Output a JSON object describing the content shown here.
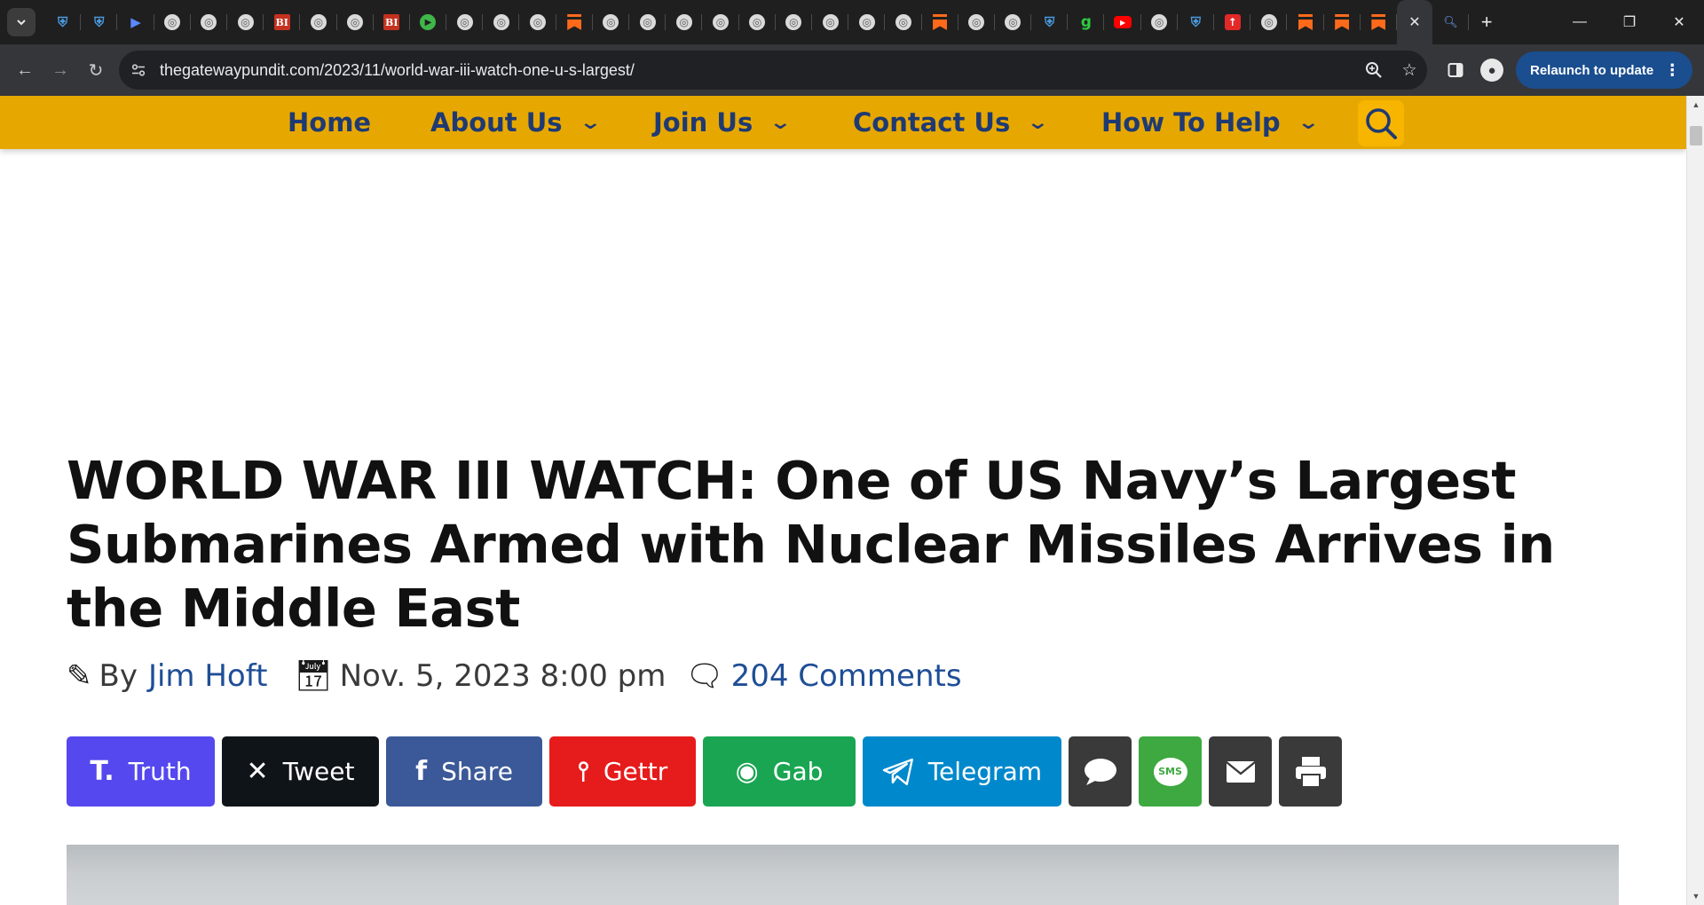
{
  "browser": {
    "url": "thegatewaypundit.com/2023/11/world-war-iii-watch-one-u-s-largest/",
    "relaunch_label": "Relaunch to update",
    "tabs": [
      {
        "icon": "shield-icon"
      },
      {
        "icon": "shield-icon"
      },
      {
        "icon": "play-badge-icon"
      },
      {
        "icon": "globe-icon"
      },
      {
        "icon": "globe-icon"
      },
      {
        "icon": "globe-icon"
      },
      {
        "icon": "bi-icon"
      },
      {
        "icon": "globe-icon"
      },
      {
        "icon": "globe-icon"
      },
      {
        "icon": "bi-icon"
      },
      {
        "icon": "play-icon"
      },
      {
        "icon": "globe-icon"
      },
      {
        "icon": "globe-icon"
      },
      {
        "icon": "globe-icon"
      },
      {
        "icon": "bookmark-flag-icon"
      },
      {
        "icon": "globe-icon"
      },
      {
        "icon": "globe-icon"
      },
      {
        "icon": "globe-icon"
      },
      {
        "icon": "globe-icon"
      },
      {
        "icon": "globe-icon"
      },
      {
        "icon": "globe-icon"
      },
      {
        "icon": "globe-icon"
      },
      {
        "icon": "globe-icon"
      },
      {
        "icon": "globe-icon"
      },
      {
        "icon": "bookmark-flag-icon"
      },
      {
        "icon": "globe-icon"
      },
      {
        "icon": "globe-icon"
      },
      {
        "icon": "shield-icon"
      },
      {
        "icon": "g-icon"
      },
      {
        "icon": "youtube-icon"
      },
      {
        "icon": "globe-icon"
      },
      {
        "icon": "shield-icon"
      },
      {
        "icon": "red-badge-icon"
      },
      {
        "icon": "globe-icon"
      },
      {
        "icon": "bookmark-flag-icon"
      },
      {
        "icon": "bookmark-flag-icon"
      },
      {
        "icon": "bookmark-flag-icon"
      }
    ]
  },
  "site_nav": {
    "items": [
      {
        "label": "Home",
        "has_dropdown": false
      },
      {
        "label": "About Us",
        "has_dropdown": true
      },
      {
        "label": "Join Us",
        "has_dropdown": true
      },
      {
        "label": "Contact Us",
        "has_dropdown": true
      },
      {
        "label": "How To Help",
        "has_dropdown": true
      }
    ],
    "colors": {
      "bar": "#e6a800",
      "text": "#1f3a73",
      "search_bg": "#f7b500"
    }
  },
  "article": {
    "headline": "WORLD WAR III WATCH: One of US Navy’s Largest Submarines Armed with Nuclear Missiles Arrives in the Middle East",
    "by_label": "By",
    "author": "Jim Hoft",
    "date": "Nov. 5, 2023 8:00 pm",
    "comments": "204 Comments"
  },
  "share_buttons": [
    {
      "label": "Truth",
      "icon": "truth-social-icon",
      "color": "#5448ee"
    },
    {
      "label": "Tweet",
      "icon": "x-icon",
      "color": "#0f1419"
    },
    {
      "label": "Share",
      "icon": "facebook-icon",
      "color": "#3b5998"
    },
    {
      "label": "Gettr",
      "icon": "gettr-icon",
      "color": "#e61b1b"
    },
    {
      "label": "Gab",
      "icon": "gab-frog-icon",
      "color": "#1aa552"
    },
    {
      "label": "Telegram",
      "icon": "telegram-icon",
      "color": "#0088cc"
    },
    {
      "label": "",
      "icon": "chat-bubble-icon",
      "color": "#3a3a3a"
    },
    {
      "label": "SMS",
      "icon": "sms-icon",
      "color": "#3da940"
    },
    {
      "label": "",
      "icon": "mail-icon",
      "color": "#3a3a3a"
    },
    {
      "label": "",
      "icon": "print-icon",
      "color": "#3a3a3a"
    }
  ]
}
